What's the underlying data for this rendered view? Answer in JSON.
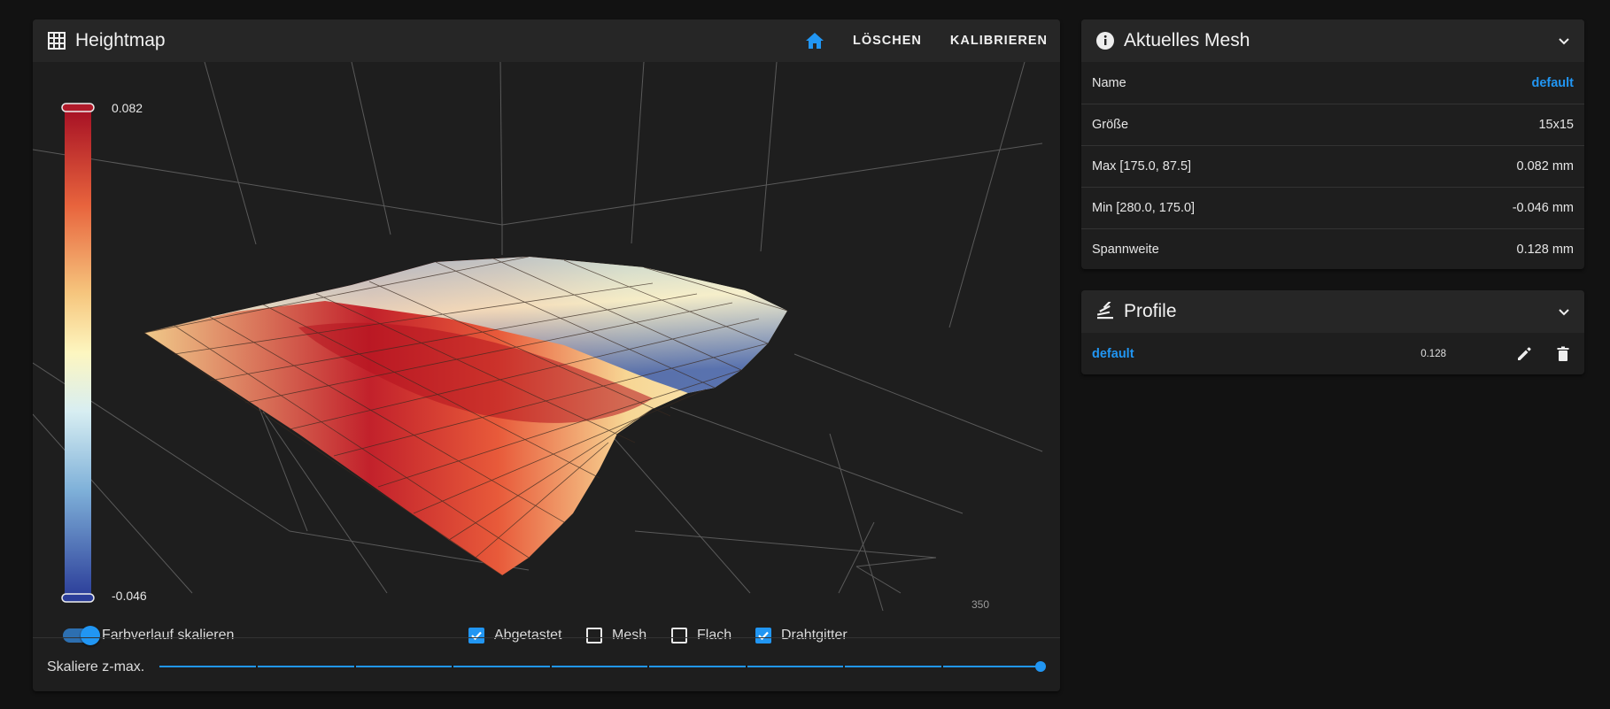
{
  "heightmap": {
    "title": "Heightmap",
    "home_icon": "home-icon",
    "delete_label": "LÖSCHEN",
    "calibrate_label": "KALIBRIEREN",
    "scale_max_label": "0.082",
    "scale_min_label": "-0.046",
    "axis_label_350": "350",
    "gradient_toggle_label": "Farbverlauf skalieren",
    "gradient_toggle_on": true,
    "checkboxes": [
      {
        "label": "Abgetastet",
        "checked": true
      },
      {
        "label": "Mesh",
        "checked": false
      },
      {
        "label": "Flach",
        "checked": false
      },
      {
        "label": "Drahtgitter",
        "checked": true
      }
    ],
    "zscale_label": "Skaliere z-max.",
    "zscale_value": 1.0
  },
  "mesh": {
    "title": "Aktuelles Mesh",
    "rows": [
      {
        "label": "Name",
        "value": "default"
      },
      {
        "label": "Größe",
        "value": "15x15"
      },
      {
        "label": "Max [175.0, 87.5]",
        "value": "0.082 mm"
      },
      {
        "label": "Min [280.0, 175.0]",
        "value": "-0.046 mm"
      },
      {
        "label": "Spannweite",
        "value": "0.128 mm"
      }
    ]
  },
  "profile": {
    "title": "Profile",
    "items": [
      {
        "name": "default",
        "range": "0.128"
      }
    ]
  },
  "colors": {
    "accent": "#2196f3",
    "card": "#1e1e1e",
    "background": "#121212",
    "scale_top": "#a50f24",
    "scale_bottom": "#2b3d99"
  }
}
